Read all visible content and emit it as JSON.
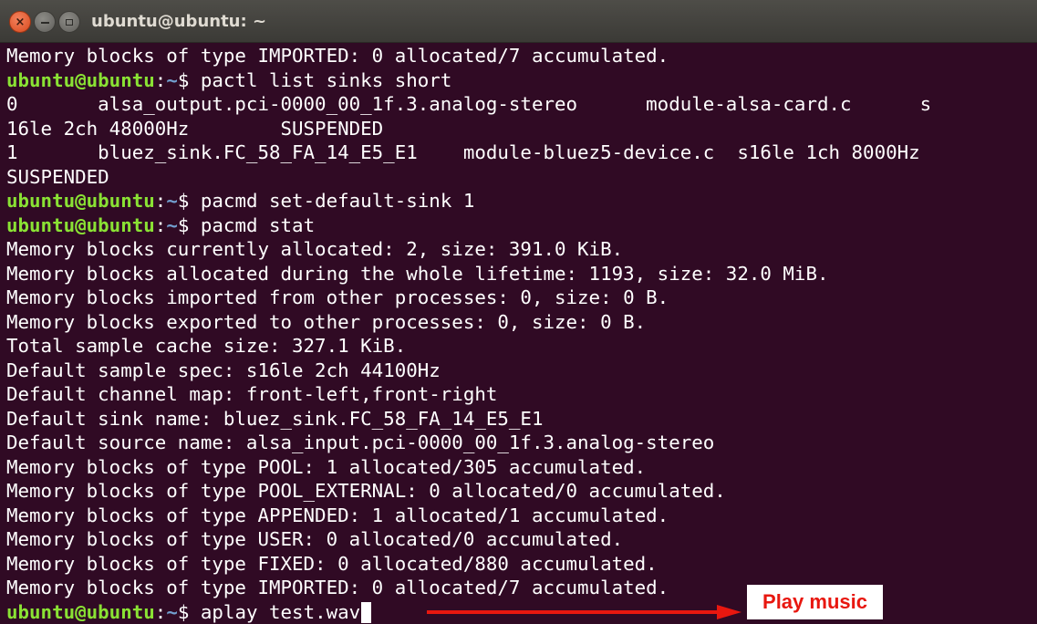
{
  "window": {
    "title": "ubuntu@ubuntu: ~",
    "buttons": {
      "close": "×",
      "minimize": "minimize",
      "maximize": "maximize"
    }
  },
  "prompt": {
    "user": "ubuntu@ubuntu",
    "sep": ":",
    "path": "~",
    "sym": "$ "
  },
  "terminal": {
    "lines": [
      {
        "text": "Memory blocks of type IMPORTED: 0 allocated/7 accumulated."
      },
      {
        "cmd": "pactl list sinks short"
      },
      {
        "text": "0       alsa_output.pci-0000_00_1f.3.analog-stereo      module-alsa-card.c      s"
      },
      {
        "text": "16le 2ch 48000Hz        SUSPENDED"
      },
      {
        "text": "1       bluez_sink.FC_58_FA_14_E5_E1    module-bluez5-device.c  s16le 1ch 8000Hz"
      },
      {
        "text": "SUSPENDED"
      },
      {
        "cmd": "pacmd set-default-sink 1"
      },
      {
        "cmd": "pacmd stat"
      },
      {
        "text": "Memory blocks currently allocated: 2, size: 391.0 KiB."
      },
      {
        "text": "Memory blocks allocated during the whole lifetime: 1193, size: 32.0 MiB."
      },
      {
        "text": "Memory blocks imported from other processes: 0, size: 0 B."
      },
      {
        "text": "Memory blocks exported to other processes: 0, size: 0 B."
      },
      {
        "text": "Total sample cache size: 327.1 KiB."
      },
      {
        "text": "Default sample spec: s16le 2ch 44100Hz"
      },
      {
        "text": "Default channel map: front-left,front-right"
      },
      {
        "text": "Default sink name: bluez_sink.FC_58_FA_14_E5_E1"
      },
      {
        "text": "Default source name: alsa_input.pci-0000_00_1f.3.analog-stereo"
      },
      {
        "text": "Memory blocks of type POOL: 1 allocated/305 accumulated."
      },
      {
        "text": "Memory blocks of type POOL_EXTERNAL: 0 allocated/0 accumulated."
      },
      {
        "text": "Memory blocks of type APPENDED: 1 allocated/1 accumulated."
      },
      {
        "text": "Memory blocks of type USER: 0 allocated/0 accumulated."
      },
      {
        "text": "Memory blocks of type FIXED: 0 allocated/880 accumulated."
      },
      {
        "text": "Memory blocks of type IMPORTED: 0 allocated/7 accumulated."
      },
      {
        "cmd": "aplay test.wav",
        "cursor": true
      }
    ]
  },
  "annotation": {
    "label": "Play music",
    "color": "#e8170f"
  },
  "colors": {
    "background": "#300a24",
    "prompt_user": "#8ae234",
    "prompt_path": "#729fcf",
    "text": "#ffffff"
  }
}
